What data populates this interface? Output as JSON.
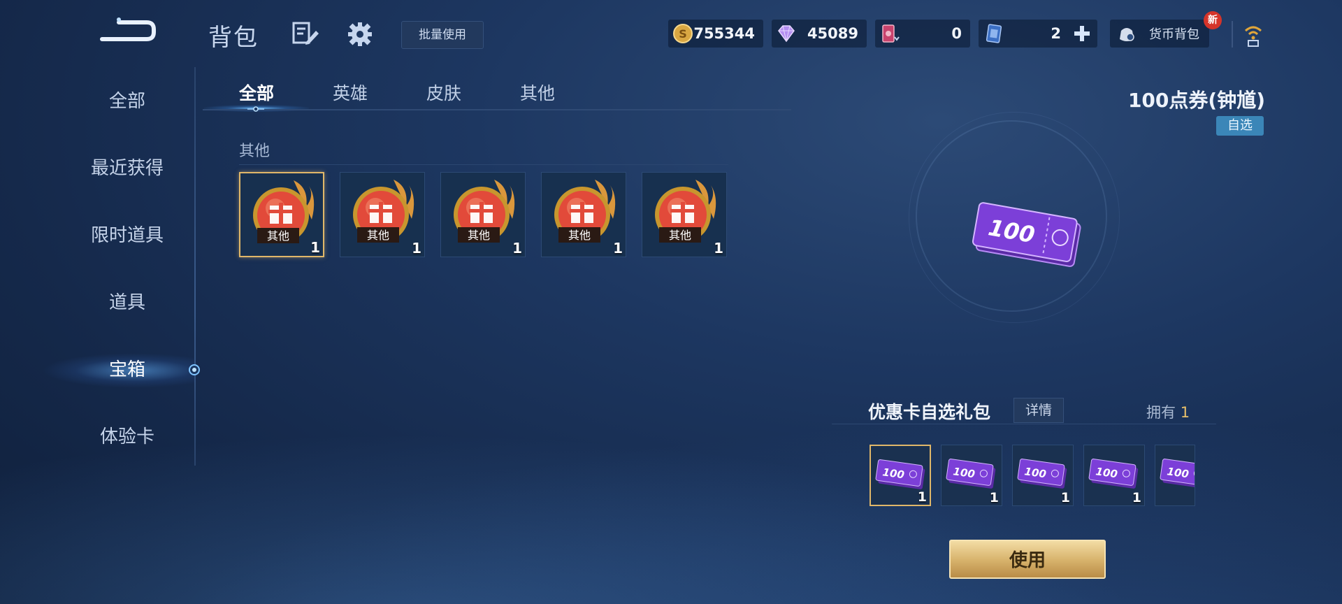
{
  "header": {
    "title": "背包",
    "batch_use_label": "批量使用",
    "currencies": [
      {
        "name": "gold-coin",
        "value": "755344"
      },
      {
        "name": "diamond",
        "value": "45089"
      },
      {
        "name": "ticket",
        "value": "0"
      },
      {
        "name": "card",
        "value": "2"
      }
    ],
    "wallet_label": "货币背包",
    "new_badge": "新"
  },
  "sidebar": {
    "items": [
      {
        "label": "全部"
      },
      {
        "label": "最近获得"
      },
      {
        "label": "限时道具"
      },
      {
        "label": "道具"
      },
      {
        "label": "宝箱",
        "active": true
      },
      {
        "label": "体验卡"
      }
    ]
  },
  "tabs": [
    {
      "label": "全部",
      "active": true
    },
    {
      "label": "英雄"
    },
    {
      "label": "皮肤"
    },
    {
      "label": "其他"
    }
  ],
  "grid": {
    "section_label": "其他",
    "items": [
      {
        "tag": "其他",
        "count": "1",
        "selected": true
      },
      {
        "tag": "其他",
        "count": "1"
      },
      {
        "tag": "其他",
        "count": "1"
      },
      {
        "tag": "其他",
        "count": "1"
      },
      {
        "tag": "其他",
        "count": "1"
      }
    ]
  },
  "detail": {
    "name": "100点券(钟馗)",
    "tag": "自选",
    "ticket_value": "100",
    "pack_title": "优惠卡自选礼包",
    "detail_button": "详情",
    "own_label": "拥有",
    "own_count": "1",
    "pack_items": [
      {
        "label": "100",
        "count": "1",
        "selected": true
      },
      {
        "label": "100",
        "count": "1"
      },
      {
        "label": "100",
        "count": "1"
      },
      {
        "label": "100",
        "count": "1"
      },
      {
        "label": "100",
        "count": ""
      }
    ],
    "use_button": "使用"
  },
  "colors": {
    "accent_gold": "#e0b769",
    "tag_blue": "#3b86b8",
    "badge_red": "#d5342a"
  }
}
